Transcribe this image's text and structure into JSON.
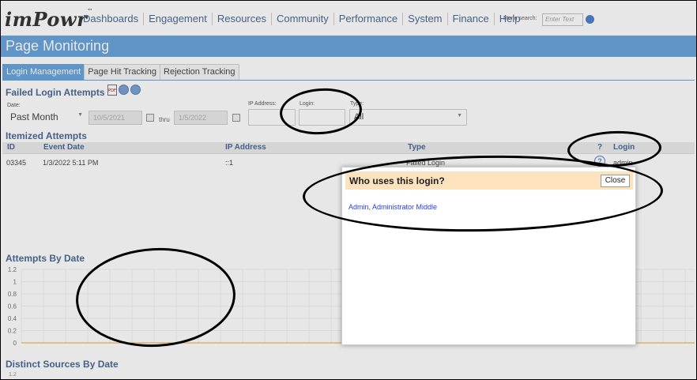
{
  "app": {
    "logo": "imPowr",
    "logo_tm": "™"
  },
  "nav": {
    "items": [
      "Dashboards",
      "Engagement",
      "Resources",
      "Community",
      "Performance",
      "System",
      "Finance",
      "Help"
    ],
    "menu_search_label": "Menu search:",
    "menu_search_placeholder": "Enter Text"
  },
  "page": {
    "title": "Page Monitoring"
  },
  "tabs": [
    "Login Management",
    "Page Hit Tracking",
    "Rejection Tracking"
  ],
  "failed_login": {
    "title": "Failed Login Attempts",
    "pdf_label": "PDF",
    "date_label": "Date:",
    "date_value": "Past Month",
    "from_date": "10/5/2021",
    "thru_label": "thru",
    "to_date": "1/5/2022",
    "ip_label": "IP Address:",
    "login_label": "Login:",
    "type_label": "Type:",
    "type_value": "All"
  },
  "itemized": {
    "title": "Itemized Attempts",
    "columns": [
      "ID",
      "Event Date",
      "IP Address",
      "Type",
      "?",
      "Login"
    ],
    "rows": [
      {
        "id": "03345",
        "date": "1/3/2022 5:11 PM",
        "ip": "::1",
        "type": "Failed Login",
        "help": "?",
        "login": "admin"
      }
    ]
  },
  "charts": {
    "attempts_title": "Attempts By Date",
    "sources_title": "Distinct Sources By Date",
    "sources_first_tick": "1.2"
  },
  "chart_data": {
    "type": "line",
    "title": "Attempts By Date",
    "y_ticks": [
      "1.2",
      "1",
      "0.8",
      "0.6",
      "0.4",
      "0.2",
      "0"
    ],
    "ylim": [
      0,
      1.2
    ],
    "series": [],
    "grid": true
  },
  "popup": {
    "title": "Who uses this login?",
    "close_label": "Close",
    "user": "Admin, Administrator Middle"
  },
  "colors": {
    "header_blue": "#5b9bd8",
    "link_blue": "#3a5b8c",
    "popup_header": "#fde3bd"
  }
}
